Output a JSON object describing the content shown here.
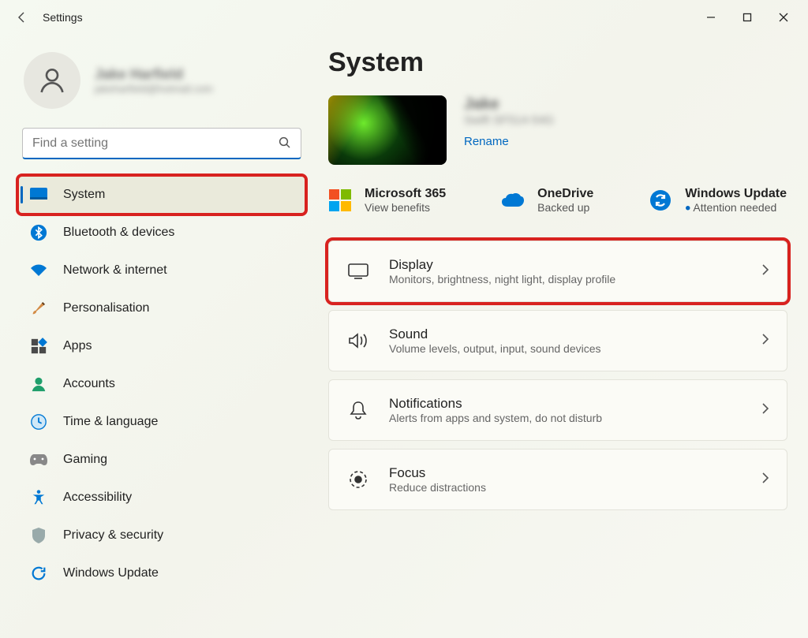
{
  "app": {
    "title": "Settings"
  },
  "profile": {
    "name": "Jake Harfield",
    "email": "jakeharfield@hotmail.com"
  },
  "search": {
    "placeholder": "Find a setting"
  },
  "sidebar": {
    "items": [
      {
        "label": "System"
      },
      {
        "label": "Bluetooth & devices"
      },
      {
        "label": "Network & internet"
      },
      {
        "label": "Personalisation"
      },
      {
        "label": "Apps"
      },
      {
        "label": "Accounts"
      },
      {
        "label": "Time & language"
      },
      {
        "label": "Gaming"
      },
      {
        "label": "Accessibility"
      },
      {
        "label": "Privacy & security"
      },
      {
        "label": "Windows Update"
      }
    ]
  },
  "page": {
    "title": "System"
  },
  "device": {
    "name": "Jake",
    "model": "Swift SF514-54G",
    "rename": "Rename"
  },
  "status": {
    "ms365": {
      "title": "Microsoft 365",
      "sub": "View benefits"
    },
    "onedrive": {
      "title": "OneDrive",
      "sub": "Backed up"
    },
    "update": {
      "title": "Windows Update",
      "sub": "Attention needed"
    }
  },
  "cards": [
    {
      "title": "Display",
      "sub": "Monitors, brightness, night light, display profile"
    },
    {
      "title": "Sound",
      "sub": "Volume levels, output, input, sound devices"
    },
    {
      "title": "Notifications",
      "sub": "Alerts from apps and system, do not disturb"
    },
    {
      "title": "Focus",
      "sub": "Reduce distractions"
    }
  ]
}
